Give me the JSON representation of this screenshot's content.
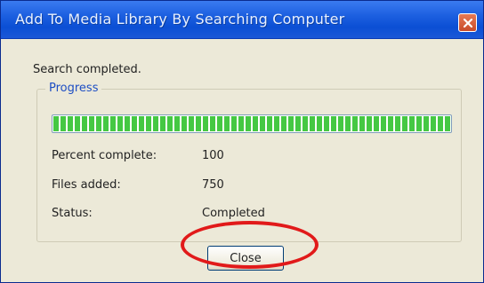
{
  "window": {
    "title": "Add To Media Library By Searching Computer",
    "close_icon": "close-icon"
  },
  "dialog": {
    "status_message": "Search completed.",
    "group_label": "Progress",
    "progress_fraction": 1.0,
    "rows": [
      {
        "label": "Percent complete:",
        "value": "100"
      },
      {
        "label": "Files added:",
        "value": "750"
      },
      {
        "label": "Status:",
        "value": "Completed"
      }
    ],
    "close_label": "Close"
  },
  "colors": {
    "titlebar": "#0b4fd4",
    "progress": "#45c843",
    "annotation": "#e11a1a"
  }
}
